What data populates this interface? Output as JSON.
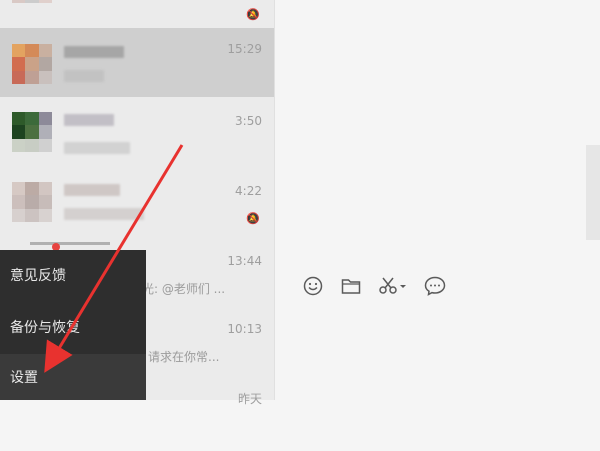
{
  "chat_list": {
    "items": [
      {
        "time": "",
        "muted": true
      },
      {
        "time": "15:29",
        "muted": false
      },
      {
        "time": "3:50",
        "muted": false
      },
      {
        "time": "4:22",
        "muted": true
      },
      {
        "time": "13:44",
        "preview": "光: @老师们 ..."
      },
      {
        "time": "10:13",
        "preview": "请求在你常..."
      },
      {
        "time": "昨天"
      }
    ]
  },
  "menu": {
    "items": [
      {
        "label": "意见反馈"
      },
      {
        "label": "备份与恢复"
      },
      {
        "label": "设置"
      }
    ]
  },
  "toolbar": {
    "icons": [
      "emoji-icon",
      "folder-icon",
      "scissors-icon",
      "chat-bubble-icon"
    ]
  },
  "colors": {
    "menu_bg": "#2e2e2e",
    "arrow": "#e8322f",
    "selected_row": "#cfcfcf"
  }
}
